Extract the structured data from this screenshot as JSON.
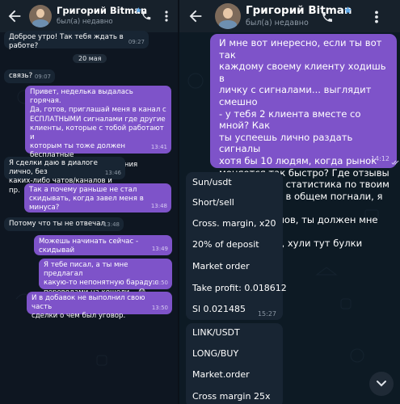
{
  "left": {
    "header": {
      "name": "Григорий Bitman",
      "status": "был(а) недавно"
    },
    "date_chip": "20 мая",
    "messages": [
      {
        "dir": "in",
        "text": "Доброе утро! Так тебя ждать в работе?",
        "time": "09:27"
      },
      {
        "dir": "in",
        "text": "связь?",
        "time": "09:07"
      },
      {
        "dir": "out",
        "text": "Привет, неделька выдалась горячая.\nДа, готов, приглашай меня в канал с\nЕСПЛАТНЫМИ сигналами где другие\nклиенты, которые с тобой работают и\nкоторым ты тоже должен бесплатные\nсигналы для восстановления\nбалансов 🤝",
        "time": "13:41"
      },
      {
        "dir": "in",
        "text": "Я сделки даю в диалоге лично, без\nкаких-либо чатов/каналов и пр.",
        "time": "13:46"
      },
      {
        "dir": "out",
        "text": "Так а почему раньше не стал\nскидывать, когда завел меня в минуса?",
        "time": "13:48"
      },
      {
        "dir": "in",
        "text": "Потому что ты не отвечал",
        "time": "13:48"
      },
      {
        "dir": "out",
        "text": "Можешь начинать сейчас - скидывай",
        "time": "13:49"
      },
      {
        "dir": "out",
        "text": "Я тебе писал, а ты мне предлагал\nкакую-то непонятную бараду с\nпереводами на кошели... 😟",
        "time": "13:50"
      },
      {
        "dir": "out",
        "text": "И в добавок не выполнил свою часть\nсделки о чем был уговор.",
        "time": "13:50"
      }
    ]
  },
  "right": {
    "header": {
      "name": "Григорий Bitman",
      "status": "был(а) недавно"
    },
    "big_message": {
      "text": "И мне вот инересно, если ты вот так\nкаждому своему клиенту ходишь в\nличку с сигналами... выглядит смешно\n- у тебя 2 клиента вместе со мной? Как\nты успеешь лично раздать сигналы\nхотя бы 10 людям, когда рынок\nменяется так быстро? Где отзывы\nили какая то статистика по твоим\nсигналам? ... в общем погнали, я жду\nтвоих сигналов, ты должен мне отбить\nмои затраты, хули тут булки мять.",
      "time": "14:12"
    },
    "signal1": {
      "lines": [
        "Sun/usdt",
        "Short/sell",
        "Cross. margin, x20",
        "20% of deposit",
        "Market order",
        "Take profit: 0.018612",
        "Sl 0.021485"
      ],
      "time": "15:27"
    },
    "signal2": {
      "lines": [
        "LINK/USDT",
        "LONG/BUY",
        "Market.order",
        "Cross margin 25x"
      ]
    }
  },
  "icons": {
    "back": "arrow-left-icon",
    "call": "phone-icon",
    "menu": "more-vertical-icon",
    "star": "star-icon",
    "read": "double-check-icon",
    "scroll": "chevron-down-icon"
  },
  "colors": {
    "outgoing": "#7e53c9",
    "incoming": "#182533",
    "header": "#17212b",
    "star": "#5fa8e8"
  }
}
